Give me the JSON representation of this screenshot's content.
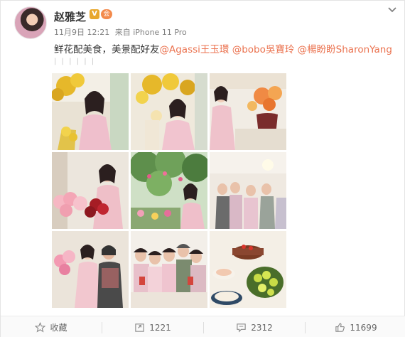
{
  "post": {
    "user_name": "赵雅芝",
    "verified_label": "V",
    "vip_label": "会",
    "date": "11月9日 12:21",
    "source": "来自 iPhone 11 Pro",
    "text_plain": "鲜花配美食，美景配好友",
    "mentions": [
      "@Agassi王玉環",
      "@bobo吳寶玲",
      "@楊盼盼SharonYang"
    ],
    "separator_text": "| | | | | |",
    "images": [
      "photo-1",
      "photo-2",
      "photo-3",
      "photo-4",
      "photo-5",
      "photo-6",
      "photo-7",
      "photo-8",
      "photo-9"
    ]
  },
  "actions": {
    "favorite_label": "收藏",
    "repost_count": "1221",
    "comment_count": "2312",
    "like_count": "11699"
  },
  "icons": {
    "more": "chevron-down-icon",
    "favorite": "star-icon",
    "repost": "repost-icon",
    "comment": "comment-icon",
    "like": "thumbs-up-icon"
  },
  "colors": {
    "mention": "#eb7350",
    "meta": "#808080",
    "text": "#333333"
  }
}
